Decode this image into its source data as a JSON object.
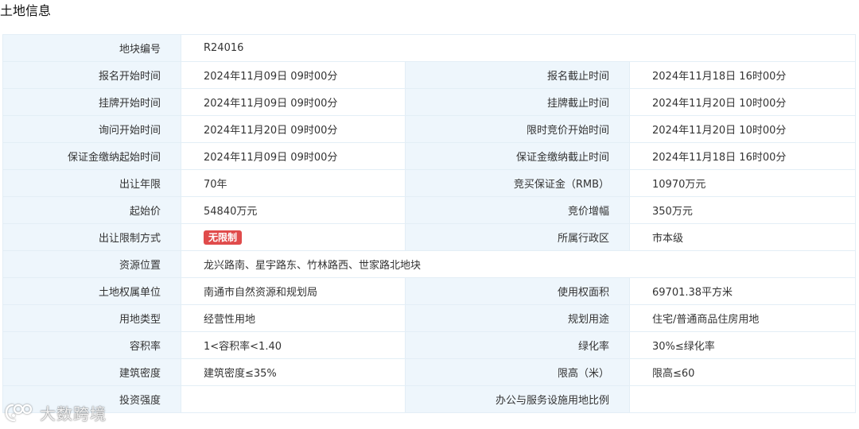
{
  "section_title": "土地信息",
  "fields": {
    "parcel_no": {
      "label": "地块编号",
      "value": "R24016"
    },
    "signup_start": {
      "label": "报名开始时间",
      "value": "2024年11月09日 09时00分"
    },
    "signup_end": {
      "label": "报名截止时间",
      "value": "2024年11月18日 16时00分"
    },
    "listing_start": {
      "label": "挂牌开始时间",
      "value": "2024年11月09日 09时00分"
    },
    "listing_end": {
      "label": "挂牌截止时间",
      "value": "2024年11月20日 10时00分"
    },
    "inquiry_start": {
      "label": "询问开始时间",
      "value": "2024年11月20日 09时00分"
    },
    "timed_bid_start": {
      "label": "限时竞价开始时间",
      "value": "2024年11月20日 10时00分"
    },
    "deposit_start": {
      "label": "保证金缴纳起始时间",
      "value": "2024年11月09日 09时00分"
    },
    "deposit_end": {
      "label": "保证金缴纳截止时间",
      "value": "2024年11月18日 16时00分"
    },
    "term": {
      "label": "出让年限",
      "value": "70年"
    },
    "deposit": {
      "label": "竞买保证金（RMB）",
      "value": "10970万元"
    },
    "start_price": {
      "label": "起始价",
      "value": "54840万元"
    },
    "increment": {
      "label": "竞价增幅",
      "value": "350万元"
    },
    "restriction": {
      "label": "出让限制方式",
      "value": "无限制"
    },
    "district": {
      "label": "所属行政区",
      "value": "市本级"
    },
    "location": {
      "label": "资源位置",
      "value": "龙兴路南、星宇路东、竹林路西、世家路北地块"
    },
    "owner": {
      "label": "土地权属单位",
      "value": "南通市自然资源和规划局"
    },
    "area": {
      "label": "使用权面积",
      "value": "69701.38平方米"
    },
    "land_type": {
      "label": "用地类型",
      "value": "经营性用地"
    },
    "planned_use": {
      "label": "规划用途",
      "value": "住宅/普通商品住房用地"
    },
    "far": {
      "label": "容积率",
      "value": "1<容积率<1.40"
    },
    "greening": {
      "label": "绿化率",
      "value": "30%≤绿化率"
    },
    "density": {
      "label": "建筑密度",
      "value": "建筑密度≤35%"
    },
    "height": {
      "label": "限高（米）",
      "value": "限高≤60"
    },
    "investment": {
      "label": "投资强度",
      "value": ""
    },
    "office_ratio": {
      "label": "办公与服务设施用地比例",
      "value": ""
    }
  },
  "watermark": {
    "text": "大数跨境",
    "icon": "camera-brand-icon"
  },
  "colors": {
    "label_bg": "#eef6fc",
    "border": "#e3eef6",
    "badge": "#e04b4b"
  }
}
